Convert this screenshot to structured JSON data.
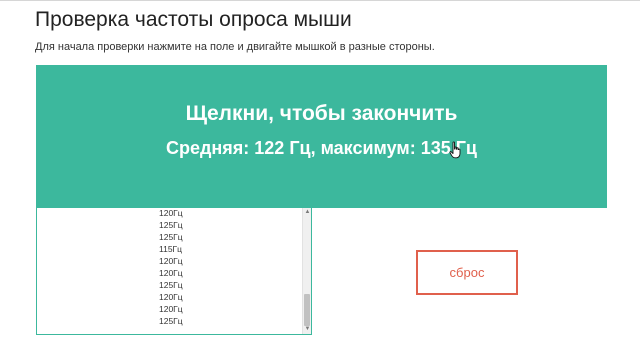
{
  "page": {
    "title": "Проверка частоты опроса мыши",
    "instructions": "Для начала проверки нажмите на поле и двигайте мышкой в разные стороны."
  },
  "test_area": {
    "headline": "Щелкни, чтобы закончить",
    "stats": "Средняя: 122 Гц, максимум: 135 Гц",
    "background_color": "#3cb89d"
  },
  "log": {
    "items": [
      "120Гц",
      "125Гц",
      "125Гц",
      "115Гц",
      "120Гц",
      "120Гц",
      "125Гц",
      "120Гц",
      "120Гц",
      "125Гц"
    ]
  },
  "reset_button": {
    "label": "сброс",
    "color": "#e0604c"
  },
  "cursor_icon": "hand-pointer-icon"
}
